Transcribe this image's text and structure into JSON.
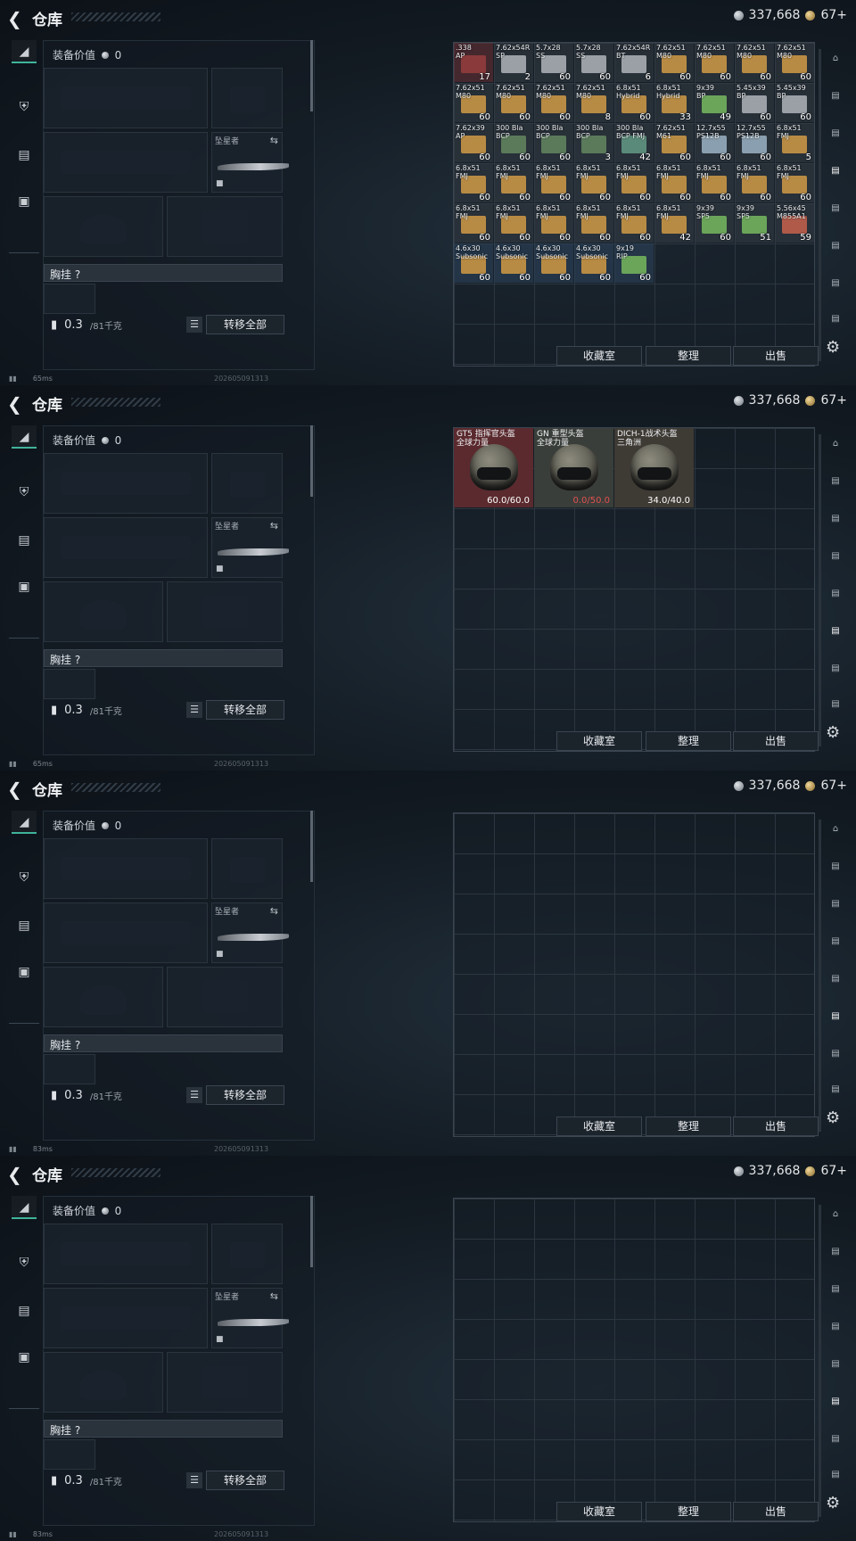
{
  "screens": [
    {
      "title": "仓库",
      "silver": "337,668",
      "gold": "67+",
      "equip_value_label": "装备价值",
      "equip_value": "0",
      "melee_label": "坠星者",
      "chest_label": "胸挂 ?",
      "weight_value": "0.3",
      "weight_max": "/81千克",
      "transfer_all": "转移全部",
      "buttons": [
        "收藏室",
        "整理",
        "出售"
      ],
      "ping": "65ms",
      "timestamp": "202605091313",
      "grid_items": [
        {
          "name": ".338\nAP",
          "qty": "17",
          "color": "#8a3a3a"
        },
        {
          "name": "7.62x54R\nSP",
          "qty": "2",
          "color": "#9aa0a6"
        },
        {
          "name": "5.7x28\nSS",
          "qty": "60",
          "color": "#9aa0a6"
        },
        {
          "name": "5.7x28\nSS",
          "qty": "60",
          "color": "#9aa0a6"
        },
        {
          "name": "7.62x54R\nBT",
          "qty": "6",
          "color": "#9aa0a6"
        },
        {
          "name": "7.62x51\nM80",
          "qty": "60",
          "color": "#b88b44"
        },
        {
          "name": "7.62x51\nM80",
          "qty": "60",
          "color": "#b88b44"
        },
        {
          "name": "7.62x51\nM80",
          "qty": "60",
          "color": "#b88b44"
        },
        {
          "name": "7.62x51\nM80",
          "qty": "60",
          "color": "#b88b44"
        },
        {
          "name": "7.62x51\nM80",
          "qty": "60",
          "color": "#b88b44"
        },
        {
          "name": "7.62x51\nM80",
          "qty": "60",
          "color": "#b88b44"
        },
        {
          "name": "7.62x51\nM80",
          "qty": "60",
          "color": "#b88b44"
        },
        {
          "name": "7.62x51\nM80",
          "qty": "8",
          "color": "#b88b44"
        },
        {
          "name": "6.8x51\nHybrid",
          "qty": "60",
          "color": "#b88b44"
        },
        {
          "name": "6.8x51\nHybrid",
          "qty": "33",
          "color": "#b88b44"
        },
        {
          "name": "9x39\nBP",
          "qty": "49",
          "color": "#6aa55a"
        },
        {
          "name": "5.45x39\nBP",
          "qty": "60",
          "color": "#9aa0a6"
        },
        {
          "name": "5.45x39\nBP",
          "qty": "60",
          "color": "#9aa0a6"
        },
        {
          "name": "7.62x39\nAP",
          "qty": "60",
          "color": "#b88b44"
        },
        {
          "name": "300 Bla\nBCP",
          "qty": "60",
          "color": "#5a7a5a"
        },
        {
          "name": "300 Bla\nBCP",
          "qty": "60",
          "color": "#5a7a5a"
        },
        {
          "name": "300 Bla\nBCP",
          "qty": "3",
          "color": "#5a7a5a"
        },
        {
          "name": "300 Bla\nBCP FMJ",
          "qty": "42",
          "color": "#5a8a7a"
        },
        {
          "name": "7.62x51\nM61",
          "qty": "60",
          "color": "#b88b44"
        },
        {
          "name": "12.7x55\nPS12B",
          "qty": "60",
          "color": "#8aa0b0"
        },
        {
          "name": "12.7x55\nPS12B",
          "qty": "60",
          "color": "#8aa0b0"
        },
        {
          "name": "6.8x51\nFMJ",
          "qty": "5",
          "color": "#b88b44"
        },
        {
          "name": "6.8x51\nFMJ",
          "qty": "60",
          "color": "#b88b44"
        },
        {
          "name": "6.8x51\nFMJ",
          "qty": "60",
          "color": "#b88b44"
        },
        {
          "name": "6.8x51\nFMJ",
          "qty": "60",
          "color": "#b88b44"
        },
        {
          "name": "6.8x51\nFMJ",
          "qty": "60",
          "color": "#b88b44"
        },
        {
          "name": "6.8x51\nFMJ",
          "qty": "60",
          "color": "#b88b44"
        },
        {
          "name": "6.8x51\nFMJ",
          "qty": "60",
          "color": "#b88b44"
        },
        {
          "name": "6.8x51\nFMJ",
          "qty": "60",
          "color": "#b88b44"
        },
        {
          "name": "6.8x51\nFMJ",
          "qty": "60",
          "color": "#b88b44"
        },
        {
          "name": "6.8x51\nFMJ",
          "qty": "60",
          "color": "#b88b44"
        },
        {
          "name": "6.8x51\nFMJ",
          "qty": "60",
          "color": "#b88b44"
        },
        {
          "name": "6.8x51\nFMJ",
          "qty": "60",
          "color": "#b88b44"
        },
        {
          "name": "6.8x51\nFMJ",
          "qty": "60",
          "color": "#b88b44"
        },
        {
          "name": "6.8x51\nFMJ",
          "qty": "60",
          "color": "#b88b44"
        },
        {
          "name": "6.8x51\nFMJ",
          "qty": "60",
          "color": "#b88b44"
        },
        {
          "name": "6.8x51\nFMJ",
          "qty": "42",
          "color": "#b88b44"
        },
        {
          "name": "9x39\nSP5",
          "qty": "60",
          "color": "#6aa55a"
        },
        {
          "name": "9x39\nSP5",
          "qty": "51",
          "color": "#6aa55a"
        },
        {
          "name": "5.56x45\nM855A1",
          "qty": "59",
          "color": "#b05a4a"
        },
        {
          "name": "4.6x30\nSubsonic",
          "qty": "60",
          "color": "#b88b44"
        },
        {
          "name": "4.6x30\nSubsonic",
          "qty": "60",
          "color": "#b88b44"
        },
        {
          "name": "4.6x30\nSubsonic",
          "qty": "60",
          "color": "#b88b44"
        },
        {
          "name": "4.6x30\nSubsonic",
          "qty": "60",
          "color": "#b88b44"
        },
        {
          "name": "9x19\nRIP",
          "qty": "60",
          "color": "#6aa55a"
        }
      ]
    },
    {
      "title": "仓库",
      "silver": "337,668",
      "gold": "67+",
      "equip_value_label": "装备价值",
      "equip_value": "0",
      "melee_label": "坠星者",
      "chest_label": "胸挂 ?",
      "weight_value": "0.3",
      "weight_max": "/81千克",
      "transfer_all": "转移全部",
      "buttons": [
        "收藏室",
        "整理",
        "出售"
      ],
      "ping": "65ms",
      "timestamp": "202605091313",
      "helmets": [
        {
          "name": "GT5 指挥官头盔\n全球力量",
          "durability": "60.0/60.0",
          "bg": "#5a2a2e"
        },
        {
          "name": "GN 重型头盔\n全球力量",
          "durability": "0.0/50.0",
          "bg": "#3a3e3a"
        },
        {
          "name": "DICH-1战术头盔\n三角洲",
          "durability": "34.0/40.0",
          "bg": "#3e3a34"
        }
      ]
    },
    {
      "title": "仓库",
      "silver": "337,668",
      "gold": "67+",
      "equip_value_label": "装备价值",
      "equip_value": "0",
      "melee_label": "坠星者",
      "chest_label": "胸挂 ?",
      "weight_value": "0.3",
      "weight_max": "/81千克",
      "transfer_all": "转移全部",
      "buttons": [
        "收藏室",
        "整理",
        "出售"
      ],
      "ping": "83ms",
      "timestamp": "202605091313"
    },
    {
      "title": "仓库",
      "silver": "337,668",
      "gold": "67+",
      "equip_value_label": "装备价值",
      "equip_value": "0",
      "melee_label": "坠星者",
      "chest_label": "胸挂 ?",
      "weight_value": "0.3",
      "weight_max": "/81千克",
      "transfer_all": "转移全部",
      "buttons": [
        "收藏室",
        "整理",
        "出售"
      ],
      "ping": "83ms",
      "timestamp": "202605091313"
    }
  ]
}
